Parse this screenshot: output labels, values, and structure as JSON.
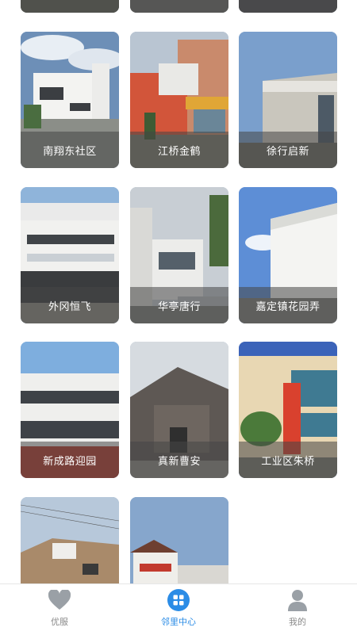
{
  "communities": [
    {
      "name": ""
    },
    {
      "name": ""
    },
    {
      "name": ""
    },
    {
      "name": "南翔东社区"
    },
    {
      "name": "江桥金鹤"
    },
    {
      "name": "徐行启新"
    },
    {
      "name": "外冈恒飞"
    },
    {
      "name": "华亭唐行"
    },
    {
      "name": "嘉定镇花园弄"
    },
    {
      "name": "新成路迎园"
    },
    {
      "name": "真新曹安"
    },
    {
      "name": "工业区朱桥"
    },
    {
      "name": ""
    },
    {
      "name": ""
    }
  ],
  "tabs": [
    {
      "label": "优服",
      "icon": "heart-icon",
      "active": false
    },
    {
      "label": "邻里中心",
      "icon": "grid-apps-icon",
      "active": true
    },
    {
      "label": "我的",
      "icon": "user-icon",
      "active": false
    }
  ],
  "colors": {
    "accent": "#2b8ce6",
    "inactive": "#8a8a8a"
  }
}
